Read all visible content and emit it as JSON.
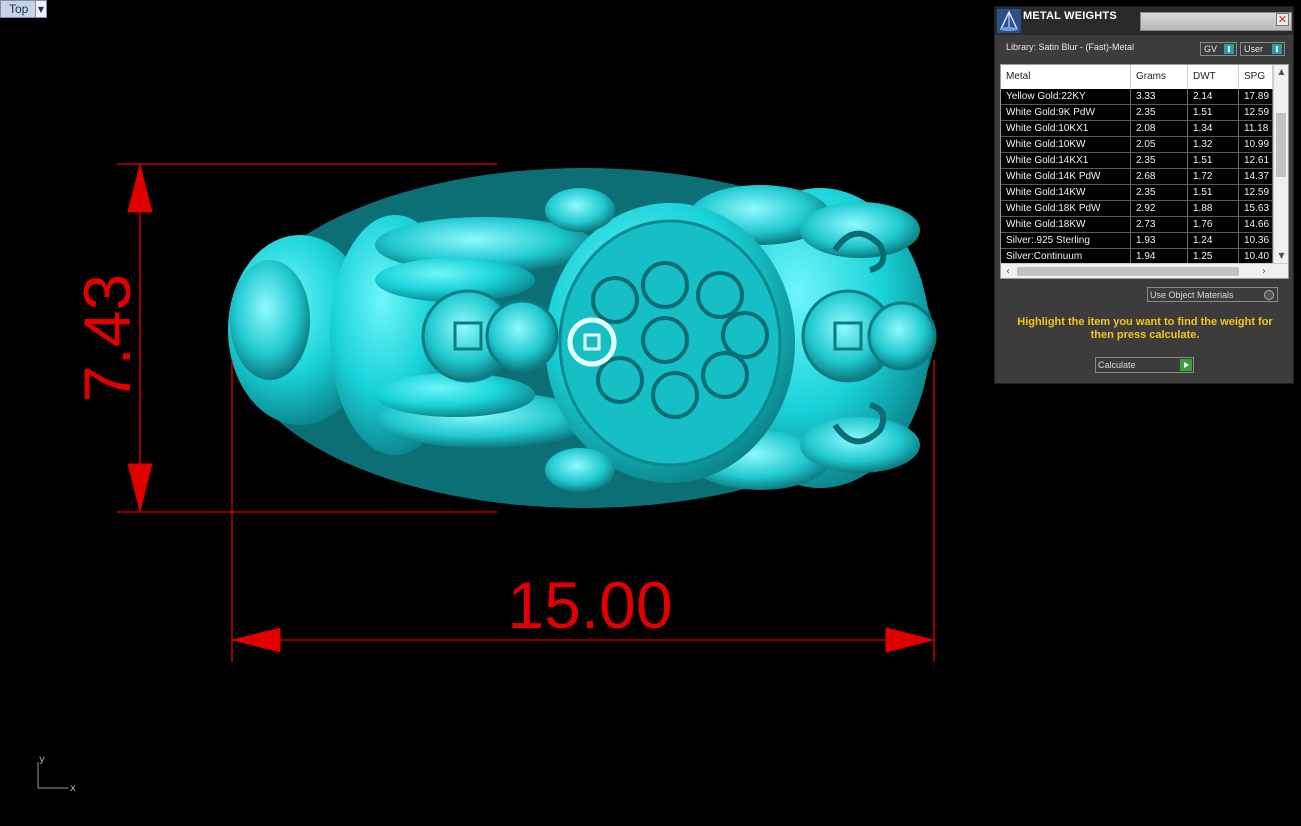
{
  "viewport": {
    "label": "Top",
    "dimensions": {
      "height_value": "7.43",
      "width_value": "15.00"
    },
    "axes": {
      "x": "x",
      "y": "y"
    }
  },
  "panel": {
    "title": "METAL WEIGHTS",
    "close_glyph": "✕",
    "library": "Library: Satin Blur - (Fast)-Metal",
    "toggle_gv": "GV",
    "toggle_user": "User",
    "columns": [
      "Metal",
      "Grams",
      "DWT",
      "SPG"
    ],
    "rows": [
      [
        "Yellow Gold:22KY",
        "3.33",
        "2.14",
        "17.89"
      ],
      [
        "White Gold:9K PdW",
        "2.35",
        "1.51",
        "12.59"
      ],
      [
        "White Gold:10KX1",
        "2.08",
        "1.34",
        "11.18"
      ],
      [
        "White Gold:10KW",
        "2.05",
        "1.32",
        "10.99"
      ],
      [
        "White Gold:14KX1",
        "2.35",
        "1.51",
        "12.61"
      ],
      [
        "White Gold:14K PdW",
        "2.68",
        "1.72",
        "14.37"
      ],
      [
        "White Gold:14KW",
        "2.35",
        "1.51",
        "12.59"
      ],
      [
        "White Gold:18K PdW",
        "2.92",
        "1.88",
        "15.63"
      ],
      [
        "White Gold:18KW",
        "2.73",
        "1.76",
        "14.66"
      ],
      [
        "Silver:.925 Sterling",
        "1.93",
        "1.24",
        "10.36"
      ],
      [
        "Silver:Continuum",
        "1.94",
        "1.25",
        "10.40"
      ]
    ],
    "use_object_materials": "Use Object Materials",
    "hint": "Highlight the item you want to find the weight for then press calculate.",
    "calculate": "Calculate",
    "icons": {
      "logo": "scales-logo-icon",
      "close": "close-icon",
      "dropdown": "chevron-down-icon"
    }
  },
  "colors": {
    "model": "#19d3d9",
    "dimension": "#e00000",
    "panel_bg": "#3c3c3c",
    "hint": "#f5c518"
  }
}
